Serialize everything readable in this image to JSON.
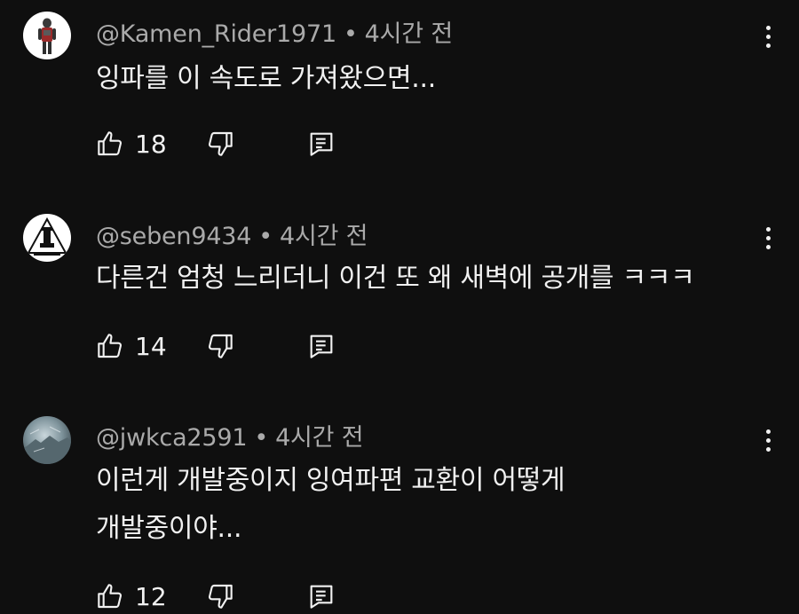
{
  "comments": [
    {
      "handle": "@Kamen_Rider1971",
      "separator": "•",
      "time": "4시간 전",
      "lines": [
        "잉파를 이 속도로 가져왔으면..."
      ],
      "likes": "18",
      "avatar_icon": "rider-figure-avatar"
    },
    {
      "handle": "@seben9434",
      "separator": "•",
      "time": "4시간 전",
      "lines": [
        "다른건 엄청 느리더니 이건 또 왜 새벽에 공개를 ㅋㅋㅋ"
      ],
      "likes": "14",
      "avatar_icon": "triangle-tower-avatar"
    },
    {
      "handle": "@jwkca2591",
      "separator": "•",
      "time": "4시간 전",
      "lines": [
        "이런게 개발중이지 잉여파편 교환이 어떻게",
        "개발중이야..."
      ],
      "likes": "12",
      "avatar_icon": "frost-landscape-avatar"
    }
  ],
  "icons": {
    "like": "thumbs-up-icon",
    "dislike": "thumbs-down-icon",
    "reply": "reply-icon",
    "more": "more-vert-icon"
  },
  "colors": {
    "background": "#0f0f0f",
    "text": "#f1f1f1",
    "meta": "#aaaaaa"
  }
}
